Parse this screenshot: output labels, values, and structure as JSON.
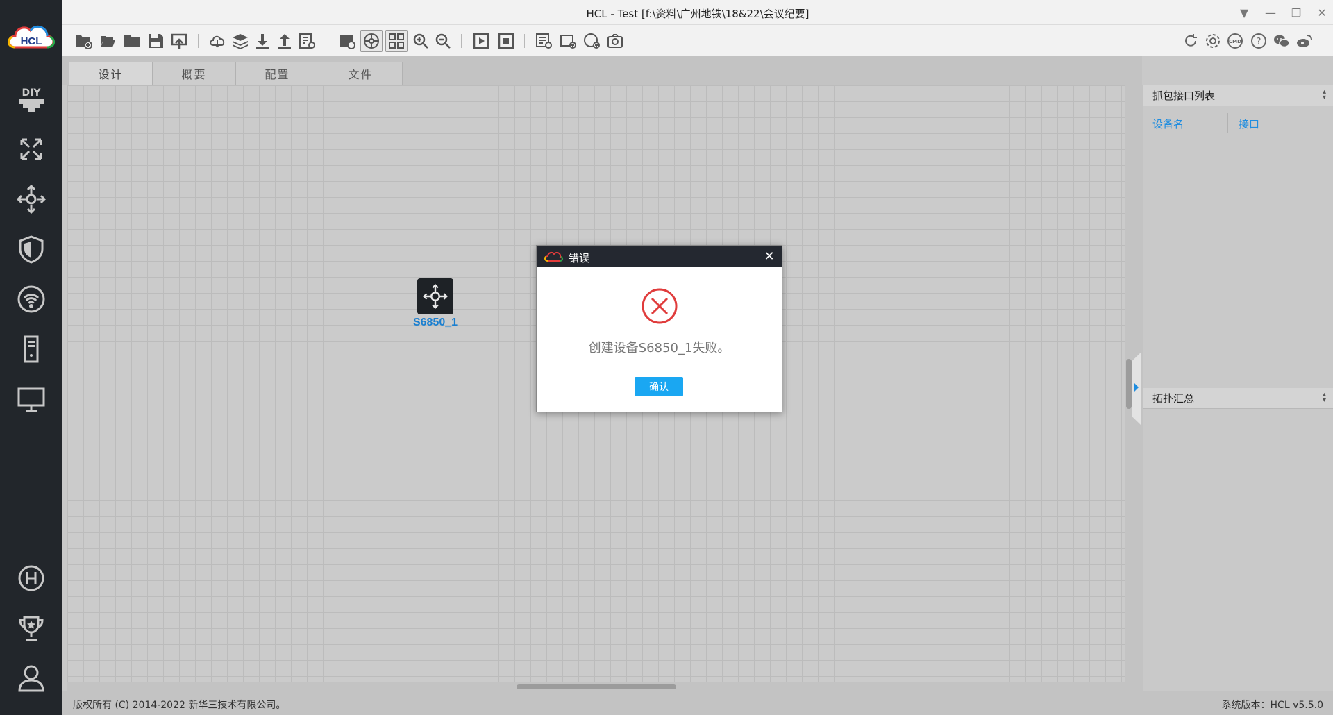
{
  "window": {
    "title": "HCL - Test [f:\\资料\\广州地铁\\18&22\\会议纪要]"
  },
  "app": {
    "logo_text": "HCL"
  },
  "tabs": [
    {
      "label": "设计",
      "active": true
    },
    {
      "label": "概要",
      "active": false
    },
    {
      "label": "配置",
      "active": false
    },
    {
      "label": "文件",
      "active": false
    }
  ],
  "canvas": {
    "devices": [
      {
        "label": "S6850_1",
        "icon": "switch-icon"
      }
    ]
  },
  "right_panel": {
    "capture_title": "抓包接口列表",
    "col_device": "设备名",
    "col_interface": "接口",
    "topology_title": "拓扑汇总"
  },
  "dialog": {
    "title": "错误",
    "message": "创建设备S6850_1失败。",
    "ok_label": "确认",
    "icon": "error-icon"
  },
  "statusbar": {
    "copyright": "版权所有 (C) 2014-2022 新华三技术有限公司。",
    "version": "系统版本：HCL v5.5.0"
  },
  "colors": {
    "sidebar_bg": "#22262b",
    "accent_blue": "#1aa7f2",
    "device_label": "#1a7fd0",
    "error_red": "#e03c3c"
  }
}
